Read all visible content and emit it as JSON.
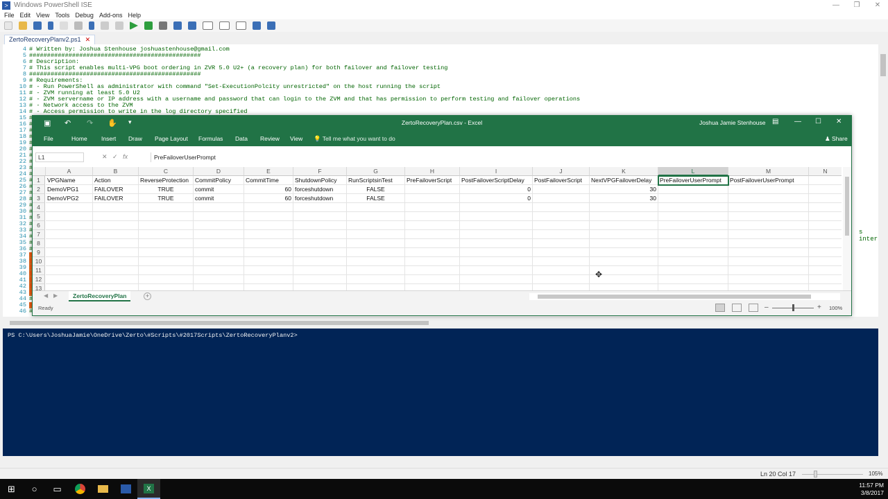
{
  "ise": {
    "title": "Windows PowerShell ISE",
    "menu": [
      "File",
      "Edit",
      "View",
      "Tools",
      "Debug",
      "Add-ons",
      "Help"
    ],
    "tab": "ZertoRecoveryPlanv2.ps1",
    "editor_lines": [
      {
        "n": "4",
        "text": "# Written by: Joshua Stenhouse joshuastenhouse@gmail.com"
      },
      {
        "n": "5",
        "text": "################################################"
      },
      {
        "n": "6",
        "text": "# Description:"
      },
      {
        "n": "7",
        "text": "# This script enables multi-VPG boot ordering in ZVR 5.0 U2+ (a recovery plan) for both failover and failover testing"
      },
      {
        "n": "8",
        "text": "################################################"
      },
      {
        "n": "9",
        "text": "# Requirements:"
      },
      {
        "n": "10",
        "text": "# - Run PowerShell as administrator with command \"Set-ExecutionPolcity unrestricted\" on the host running the script"
      },
      {
        "n": "11",
        "text": "# - ZVM running at least 5.0 U2"
      },
      {
        "n": "12",
        "text": "# - ZVM servername or IP address with a username and password that can login to the ZVM and that has permission to perform testing and failover operations"
      },
      {
        "n": "13",
        "text": "# - Network access to the ZVM"
      },
      {
        "n": "14",
        "text": "# - Access permission to write in the log directory specified"
      },
      {
        "n": "15",
        "text": "#"
      },
      {
        "n": "16",
        "text": "#"
      },
      {
        "n": "17",
        "text": "#"
      },
      {
        "n": "18",
        "text": "#"
      },
      {
        "n": "19",
        "text": "#"
      },
      {
        "n": "20",
        "text": "#"
      },
      {
        "n": "21",
        "text": "#"
      },
      {
        "n": "22",
        "text": "#"
      },
      {
        "n": "23",
        "text": "#"
      },
      {
        "n": "24",
        "text": "#"
      },
      {
        "n": "25",
        "text": "#"
      },
      {
        "n": "26",
        "text": "#"
      },
      {
        "n": "27",
        "text": "#"
      },
      {
        "n": "28",
        "text": "#"
      },
      {
        "n": "29",
        "text": "#"
      },
      {
        "n": "30",
        "text": "#"
      },
      {
        "n": "31",
        "text": "#"
      },
      {
        "n": "32",
        "text": "#"
      },
      {
        "n": "33",
        "text": "#"
      },
      {
        "n": "34",
        "text": "#"
      },
      {
        "n": "35",
        "text": "#"
      },
      {
        "n": "36",
        "text": "#"
      },
      {
        "n": "37",
        "text": "$"
      },
      {
        "n": "38",
        "text": "$"
      },
      {
        "n": "39",
        "text": "$"
      },
      {
        "n": "40",
        "text": "$"
      },
      {
        "n": "41",
        "text": "$"
      },
      {
        "n": "42",
        "text": "$"
      },
      {
        "n": "43",
        "text": "$"
      },
      {
        "n": "44",
        "text": "#"
      },
      {
        "n": "45",
        "text": "$"
      },
      {
        "n": "46",
        "text": "#"
      }
    ],
    "editor_overflow": "s interr",
    "console_prompt": "PS C:\\Users\\JoshuaJamie\\OneDrive\\Zerto\\#Scripts\\#2017Scripts\\ZertoRecoveryPlanv2>",
    "status_lncol": "Ln 20  Col 17",
    "zoom": "105%"
  },
  "taskbar": {
    "time": "11:57 PM",
    "date": "3/8/2017"
  },
  "excel": {
    "doc_title": "ZertoRecoveryPlan.csv  -  Excel",
    "user": "Joshua Jamie Stenhouse",
    "ribbon_tabs": [
      "File",
      "Home",
      "Insert",
      "Draw",
      "Page Layout",
      "Formulas",
      "Data",
      "Review",
      "View"
    ],
    "tell_me": "Tell me what you want to do",
    "share": "Share",
    "name_box": "L1",
    "formula": "PreFailoverUserPrompt",
    "columns": [
      "A",
      "B",
      "C",
      "D",
      "E",
      "F",
      "G",
      "H",
      "I",
      "J",
      "K",
      "L",
      "M",
      "N"
    ],
    "selected_column": "L",
    "rows": [
      [
        "VPGName",
        "Action",
        "ReverseProtection",
        "CommitPolicy",
        "CommitTime",
        "ShutdownPolicy",
        "RunScriptsinTest",
        "PreFailoverScript",
        "PostFailoverScriptDelay",
        "PostFailoverScript",
        "NextVPGFailoverDelay",
        "PreFailoverUserPrompt",
        "PostFailoverUserPrompt",
        ""
      ],
      [
        "DemoVPG1",
        "FAILOVER",
        "TRUE",
        "commit",
        "60",
        "forceshutdown",
        "FALSE",
        "",
        "0",
        "",
        "30",
        "",
        "",
        ""
      ],
      [
        "DemoVPG2",
        "FAILOVER",
        "TRUE",
        "commit",
        "60",
        "forceshutdown",
        "FALSE",
        "",
        "0",
        "",
        "30",
        "",
        "",
        ""
      ],
      [
        "",
        "",
        "",
        "",
        "",
        "",
        "",
        "",
        "",
        "",
        "",
        "",
        "",
        ""
      ],
      [
        "",
        "",
        "",
        "",
        "",
        "",
        "",
        "",
        "",
        "",
        "",
        "",
        "",
        ""
      ],
      [
        "",
        "",
        "",
        "",
        "",
        "",
        "",
        "",
        "",
        "",
        "",
        "",
        "",
        ""
      ],
      [
        "",
        "",
        "",
        "",
        "",
        "",
        "",
        "",
        "",
        "",
        "",
        "",
        "",
        ""
      ],
      [
        "",
        "",
        "",
        "",
        "",
        "",
        "",
        "",
        "",
        "",
        "",
        "",
        "",
        ""
      ],
      [
        "",
        "",
        "",
        "",
        "",
        "",
        "",
        "",
        "",
        "",
        "",
        "",
        "",
        ""
      ],
      [
        "",
        "",
        "",
        "",
        "",
        "",
        "",
        "",
        "",
        "",
        "",
        "",
        "",
        ""
      ],
      [
        "",
        "",
        "",
        "",
        "",
        "",
        "",
        "",
        "",
        "",
        "",
        "",
        "",
        ""
      ],
      [
        "",
        "",
        "",
        "",
        "",
        "",
        "",
        "",
        "",
        "",
        "",
        "",
        "",
        ""
      ],
      [
        "",
        "",
        "",
        "",
        "",
        "",
        "",
        "",
        "",
        "",
        "",
        "",
        "",
        ""
      ]
    ],
    "sheet_tab": "ZertoRecoveryPlan",
    "status": "Ready",
    "zoom": "100%"
  },
  "colors": {
    "excel_green": "#217346",
    "console_bg": "#012456",
    "comment_green": "#006400"
  }
}
